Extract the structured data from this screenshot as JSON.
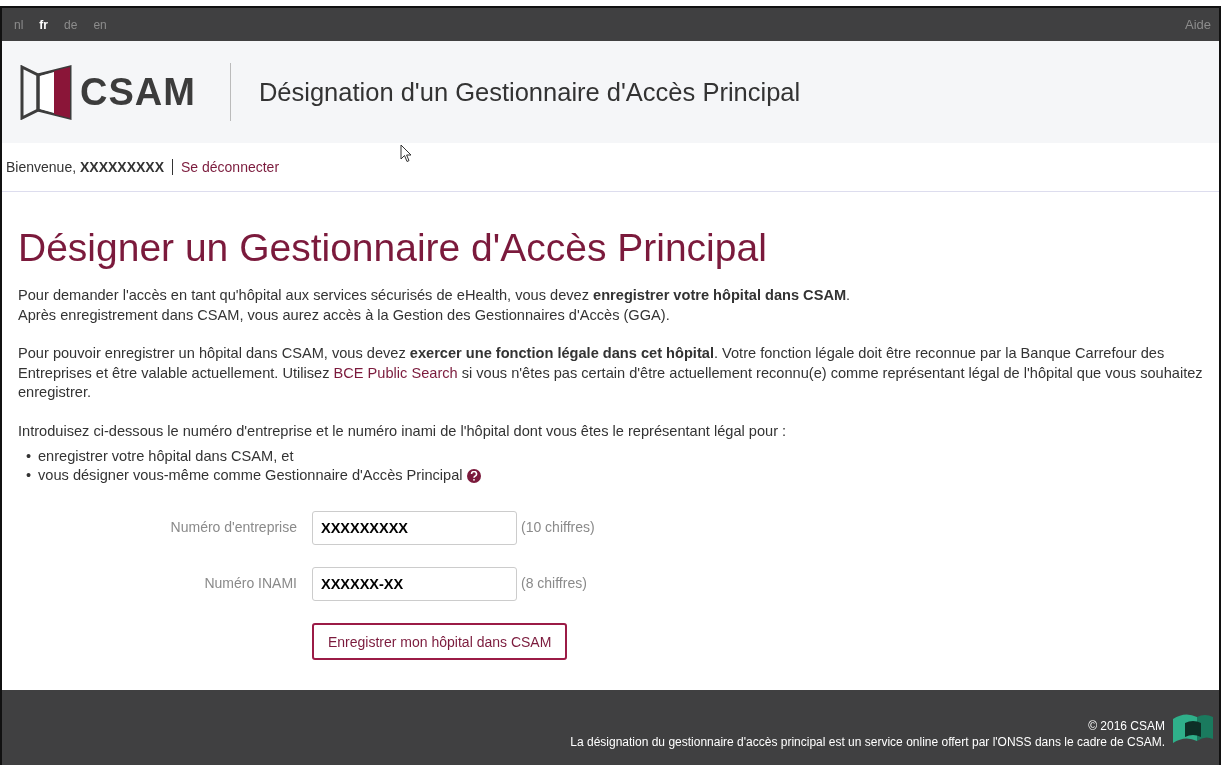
{
  "languages": [
    {
      "label": "nl",
      "selected": false
    },
    {
      "label": "fr",
      "selected": true
    },
    {
      "label": "de",
      "selected": false
    },
    {
      "label": "en",
      "selected": false
    }
  ],
  "help_link": "Aide",
  "header": {
    "logo_text": "CSAM",
    "title": "Désignation d'un Gestionnaire d'Accès Principal"
  },
  "user_bar": {
    "greeting": "Bienvenue, **XXXXXXXXX**",
    "logout_link": "Se déconnecter"
  },
  "page_title": "Désigner un Gestionnaire d'Accès Principal",
  "paragraphs": [
    [
      {
        "kind": "text",
        "text": "Pour demander l'accès en tant qu'hôpital aux services sécurisés de eHealth, vous devez **enregistrer votre hôpital dans CSAM**.\nAprès enregistrement dans CSAM, vous aurez accès à la Gestion des Gestionnaires d'Accès (GGA)."
      }
    ],
    [
      {
        "kind": "text",
        "text": "Pour pouvoir enregistrer un hôpital dans CSAM, vous devez **exercer une fonction légale dans cet hôpital**. Votre fonction légale doit être reconnue par la Banque Carrefour des Entreprises et être valable actuellement. Utilisez "
      },
      {
        "kind": "link",
        "text": "BCE Public Search"
      },
      {
        "kind": "text",
        "text": " si vous n'êtes pas certain d'être actuellement reconnu(e) comme représentant légal de l'hôpital que vous souhaitez enregistrer."
      }
    ],
    [
      {
        "kind": "text",
        "text": "Introduisez ci-dessous le numéro d'entreprise et le numéro inami de l'hôpital dont vous êtes le représentant légal pour :"
      }
    ]
  ],
  "bullets": [
    {
      "marker": "•",
      "text": "enregistrer votre hôpital dans CSAM, et",
      "help": false
    },
    {
      "marker": "•",
      "text": "vous désigner vous-même comme Gestionnaire d'Accès Principal",
      "help": true
    }
  ],
  "form": {
    "fields": [
      {
        "label": "Numéro d'entreprise",
        "value": "XXXXXXXXX",
        "hint": "(10 chiffres)"
      },
      {
        "label": "Numéro INAMI",
        "value": "XXXXXX-XX",
        "hint": "(8 chiffres)"
      }
    ],
    "submit": "Enregistrer mon hôpital dans CSAM"
  },
  "footer": {
    "copyright": "© 2016 CSAM",
    "note": "La désignation du gestionnaire d'accès principal est un service online offert par l'ONSS dans le cadre de CSAM."
  }
}
